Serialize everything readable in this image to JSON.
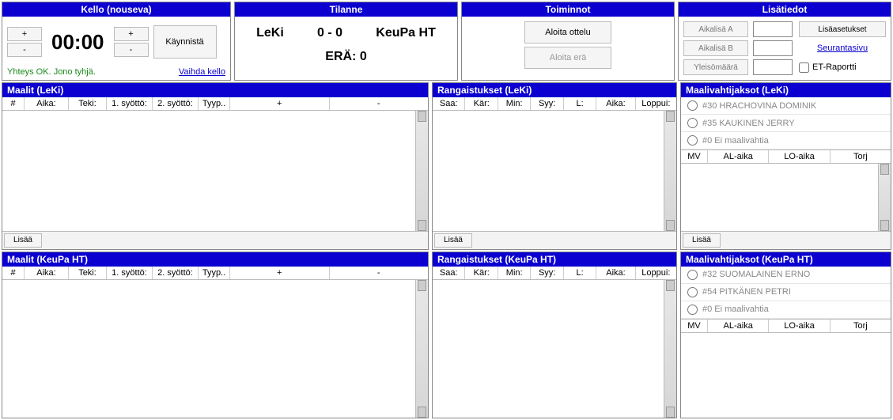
{
  "clock": {
    "title": "Kello (nouseva)",
    "plus": "+",
    "minus": "-",
    "time": "00:00",
    "start_label": "Käynnistä",
    "status": "Yhteys OK. Jono tyhjä.",
    "swap_link": "Vaihda kello"
  },
  "status": {
    "title": "Tilanne",
    "home_team": "LeKi",
    "score": "0 - 0",
    "away_team": "KeuPa HT",
    "period_label": "ERÄ: 0"
  },
  "actions": {
    "title": "Toiminnot",
    "start_match": "Aloita ottelu",
    "start_period": "Aloita erä"
  },
  "extra": {
    "title": "Lisätiedot",
    "timeout_a": "Aikalisä A",
    "timeout_b": "Aikalisä B",
    "attendance": "Yleisömäärä",
    "settings": "Lisäasetukset",
    "follow_link": "Seurantasivu",
    "et_report": "ET-Raportti"
  },
  "goals_home": {
    "title": "Maalit (LeKi)",
    "cols": {
      "num": "#",
      "time": "Aika:",
      "by": "Teki:",
      "a1": "1. syöttö:",
      "a2": "2. syöttö:",
      "type": "Tyyp..",
      "plus": "+",
      "minus": "-"
    },
    "add": "Lisää"
  },
  "goals_away": {
    "title": "Maalit (KeuPa HT)",
    "cols": {
      "num": "#",
      "time": "Aika:",
      "by": "Teki:",
      "a1": "1. syöttö:",
      "a2": "2. syöttö:",
      "type": "Tyyp..",
      "plus": "+",
      "minus": "-"
    }
  },
  "pen_home": {
    "title": "Rangaistukset (LeKi)",
    "cols": {
      "rec": "Saa:",
      "serv": "Kär:",
      "min": "Min:",
      "reason": "Syy:",
      "l": "L:",
      "time": "Aika:",
      "end": "Loppui:"
    },
    "add": "Lisää"
  },
  "pen_away": {
    "title": "Rangaistukset (KeuPa HT)",
    "cols": {
      "rec": "Saa:",
      "serv": "Kär:",
      "min": "Min:",
      "reason": "Syy:",
      "l": "L:",
      "time": "Aika:",
      "end": "Loppui:"
    }
  },
  "gk_home": {
    "title": "Maalivahtijaksot (LeKi)",
    "opts": [
      "#30 HRACHOVINA DOMINIK",
      "#35 KAUKINEN JERRY",
      "#0 Ei maalivahtia"
    ],
    "cols": {
      "mv": "MV",
      "al": "AL-aika",
      "lo": "LO-aika",
      "torj": "Torj"
    },
    "add": "Lisää"
  },
  "gk_away": {
    "title": "Maalivahtijaksot (KeuPa HT)",
    "opts": [
      "#32 SUOMALAINEN ERNO",
      "#54 PITKÄNEN PETRI",
      "#0 Ei maalivahtia"
    ],
    "cols": {
      "mv": "MV",
      "al": "AL-aika",
      "lo": "LO-aika",
      "torj": "Torj"
    }
  }
}
